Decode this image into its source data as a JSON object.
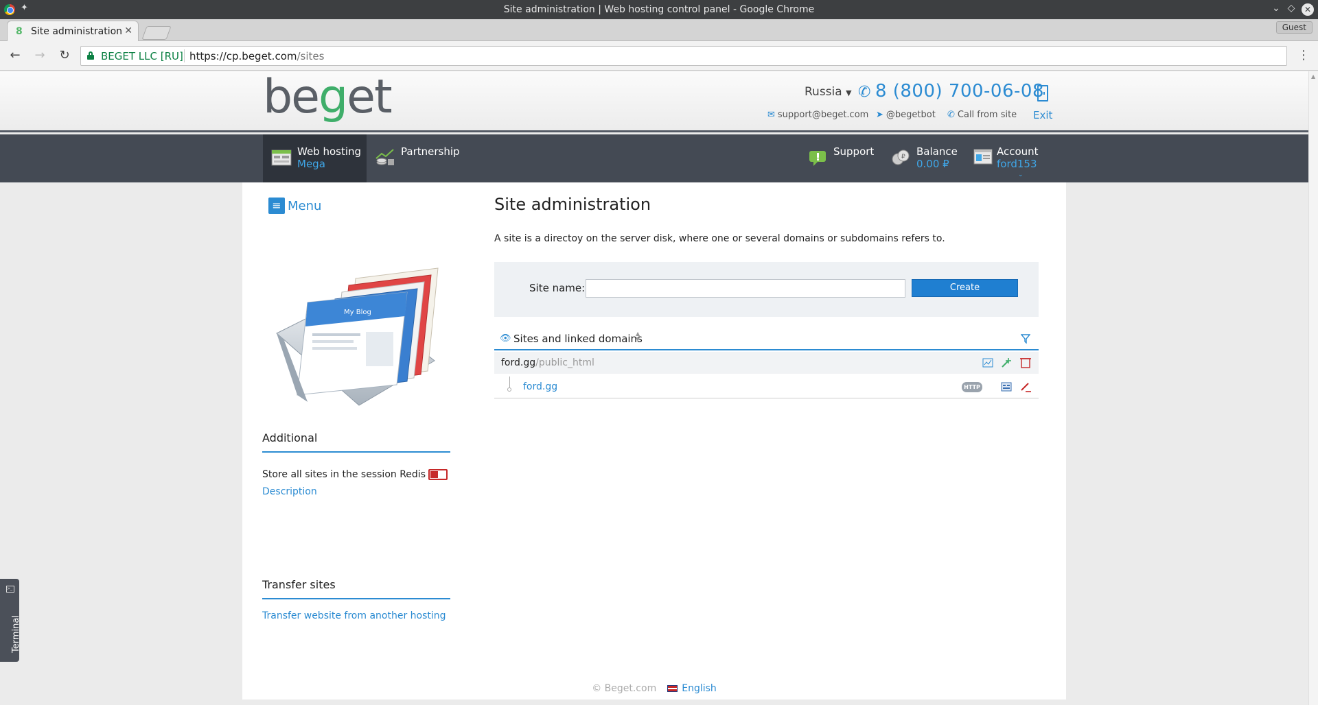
{
  "browser": {
    "window_title": "Site administration | Web hosting control panel - Google Chrome",
    "tab_title": "Site administration",
    "profile_label": "Guest",
    "security_label": "BEGET LLC [RU]",
    "url_base": "https://cp.beget.com",
    "url_path": "/sites"
  },
  "header": {
    "logo_before": "be",
    "logo_g": "g",
    "logo_after": "et",
    "country": "Russia",
    "phone": "8 (800) 700-06-08",
    "email": "support@beget.com",
    "telegram": "@begetbot",
    "call_label": "Call from site",
    "exit_label": "Exit"
  },
  "nav": {
    "hosting_label": "Web hosting",
    "hosting_plan": "Mega",
    "partnership_label": "Partnership",
    "support_label": "Support",
    "balance_label": "Balance",
    "balance_value": "0.00 ₽",
    "account_label": "Account",
    "account_value": "ford153"
  },
  "sidebar": {
    "menu_label": "Menu",
    "additional_heading": "Additional",
    "redis_label": "Store all sites in the session Redis",
    "redis_enabled": true,
    "description_link": "Description",
    "transfer_heading": "Transfer sites",
    "transfer_link": "Transfer website from another hosting"
  },
  "main": {
    "title": "Site administration",
    "intro": "A site is a directoy on the server disk, where one or several domains or subdomains refers to.",
    "site_name_label": "Site name:",
    "site_name_value": "",
    "create_button": "Create",
    "list_title": "Sites and linked domains",
    "sites": [
      {
        "name": "ford.gg",
        "dir": "/public_html",
        "domains": [
          {
            "name": "ford.gg",
            "badge": "HTTP"
          }
        ]
      }
    ]
  },
  "footer": {
    "copyright": "© Beget.com",
    "language": "English"
  },
  "terminal": {
    "label": "Terminal"
  },
  "colors": {
    "accent": "#2b8bd2",
    "navbar": "#444a54",
    "green": "#3fae6a",
    "danger": "#c62828"
  }
}
